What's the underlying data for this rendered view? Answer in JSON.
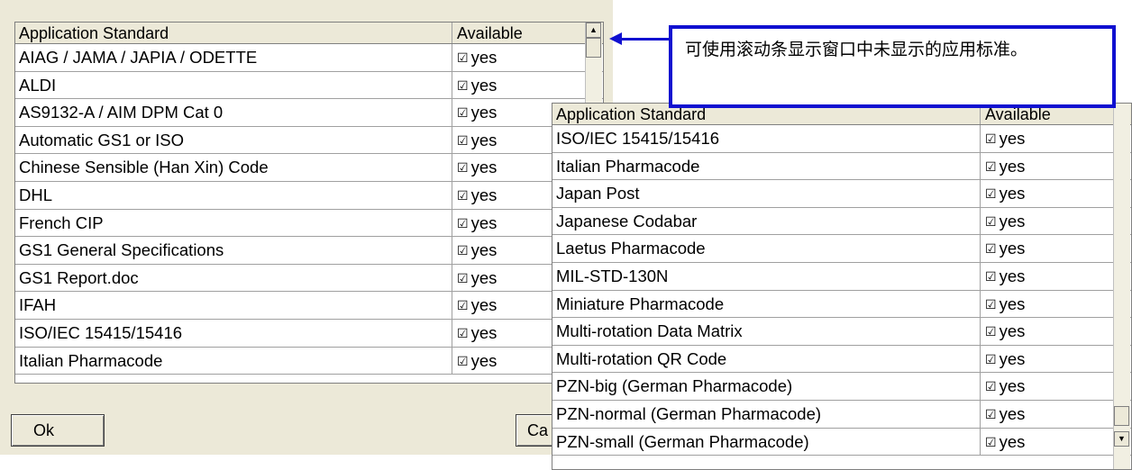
{
  "dialog": {
    "grid": {
      "headers": {
        "name": "Application Standard",
        "available": "Available"
      },
      "rows": [
        {
          "name": "AIAG / JAMA / JAPIA / ODETTE",
          "available": "yes"
        },
        {
          "name": "ALDI",
          "available": "yes"
        },
        {
          "name": "AS9132-A / AIM DPM Cat 0",
          "available": "yes"
        },
        {
          "name": "Automatic GS1 or ISO",
          "available": "yes"
        },
        {
          "name": "Chinese Sensible (Han Xin) Code",
          "available": "yes"
        },
        {
          "name": "DHL",
          "available": "yes"
        },
        {
          "name": "French CIP",
          "available": "yes"
        },
        {
          "name": "GS1 General Specifications",
          "available": "yes"
        },
        {
          "name": "GS1 Report.doc",
          "available": "yes"
        },
        {
          "name": "IFAH",
          "available": "yes"
        },
        {
          "name": "ISO/IEC 15415/15416",
          "available": "yes"
        },
        {
          "name": "Italian Pharmacode",
          "available": "yes"
        }
      ]
    },
    "ok_label": "Ok",
    "cancel_label": "Ca"
  },
  "scrolled_view": {
    "headers": {
      "name": "Application Standard",
      "available": "Available"
    },
    "rows": [
      {
        "name": "ISO/IEC 15415/15416",
        "available": "yes"
      },
      {
        "name": "Italian Pharmacode",
        "available": "yes"
      },
      {
        "name": "Japan Post",
        "available": "yes"
      },
      {
        "name": "Japanese Codabar",
        "available": "yes"
      },
      {
        "name": "Laetus Pharmacode",
        "available": "yes"
      },
      {
        "name": "MIL-STD-130N",
        "available": "yes"
      },
      {
        "name": "Miniature Pharmacode",
        "available": "yes"
      },
      {
        "name": "Multi-rotation Data Matrix",
        "available": "yes"
      },
      {
        "name": "Multi-rotation QR Code",
        "available": "yes"
      },
      {
        "name": "PZN-big (German Pharmacode)",
        "available": "yes"
      },
      {
        "name": "PZN-normal (German Pharmacode)",
        "available": "yes"
      },
      {
        "name": "PZN-small (German Pharmacode)",
        "available": "yes"
      }
    ]
  },
  "callout": {
    "text": "可使用滚动条显示窗口中未显示的应用标准。",
    "color": "#1010d0"
  },
  "icons": {
    "checkbox": "☑",
    "scroll_up": "▲",
    "scroll_down": "▼"
  }
}
